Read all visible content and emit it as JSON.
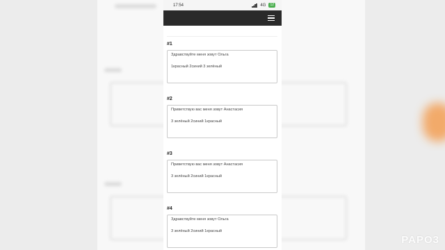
{
  "status_bar": {
    "time": "17:54",
    "network": "4G",
    "battery": "12"
  },
  "entries": [
    {
      "label": "#1",
      "line1": "Здравствуйте меня зовут Ольга",
      "line2": "1красный 2синий 3 зелёный"
    },
    {
      "label": "#2",
      "line1": "Приветствую вас меня зовут Анастасия",
      "line2": "3 зелёный 2синий 1красный"
    },
    {
      "label": "#3",
      "line1": "Приветствую вас меня зовут Анастасия",
      "line2": "3 зелёный 2синий 1красный"
    },
    {
      "label": "#4",
      "line1": "Здравствуйте меня зовут Ольга",
      "line2": "3 зелёный 2синий 1красный"
    }
  ],
  "watermark": "PAPO3",
  "colors": {
    "navbar": "#2a2a2a",
    "accent": "#f5a55c",
    "battery": "#4caf50"
  },
  "icons": {
    "menu": "hamburger-icon",
    "signal": "signal-icon",
    "battery": "battery-icon"
  }
}
